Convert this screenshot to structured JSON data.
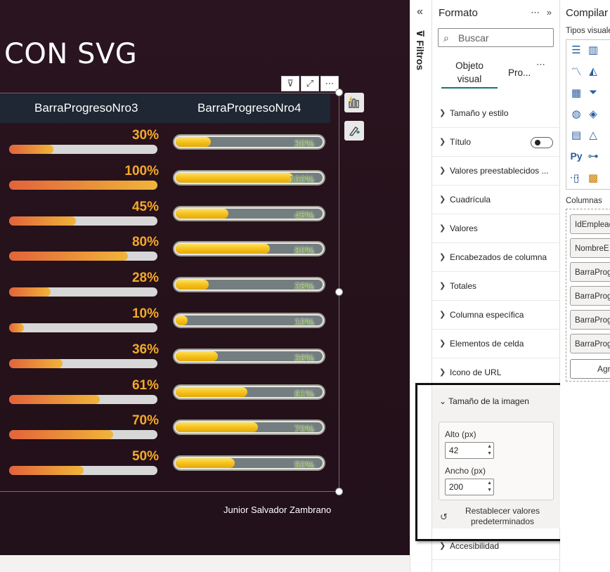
{
  "report": {
    "title": "CON SVG",
    "author": "Junior Salvador Zambrano",
    "column_headers": [
      "BarraProgresoNro3",
      "BarraProgresoNro4"
    ],
    "rows": [
      {
        "label": "30%",
        "value": 30
      },
      {
        "label": "100%",
        "value": 100
      },
      {
        "label": "45%",
        "value": 45
      },
      {
        "label": "80%",
        "value": 80
      },
      {
        "label": "28%",
        "value": 28
      },
      {
        "label": "10%",
        "value": 10
      },
      {
        "label": "36%",
        "value": 36
      },
      {
        "label": "61%",
        "value": 61
      },
      {
        "label": "70%",
        "value": 70
      },
      {
        "label": "50%",
        "value": 50
      }
    ],
    "colors": {
      "bar3_start": "#e2633b",
      "bar3_end": "#f0b53a",
      "pct3_text": "#f4a82a",
      "pct4_text": "#7ea05a",
      "bar4_fill": "#f5c21a",
      "bar4_track": "#747d80"
    }
  },
  "header_icons": [
    "filter-icon",
    "focus-mode-icon",
    "more-options-icon"
  ],
  "header_icon_glyphs": [
    "⊽",
    "⤢",
    "⋯"
  ],
  "filters_pane": {
    "label": "Filtros",
    "collapse_glyph": "«"
  },
  "format_pane": {
    "title": "Formato",
    "actions_glyph": "⋯ »",
    "search_placeholder": "Buscar",
    "tabs": {
      "visual_line1": "Objeto",
      "visual_line2": "visual",
      "properties": "Pro...",
      "more": "⋯"
    },
    "sections": [
      "Tamaño y estilo",
      "Título",
      "Valores preestablecidos ...",
      "Cuadrícula",
      "Valores",
      "Encabezados de columna",
      "Totales",
      "Columna específica",
      "Elementos de celda",
      "Icono de URL"
    ],
    "image_size": {
      "header": "Tamaño de la imagen",
      "height_label": "Alto (px)",
      "height_value": "42",
      "width_label": "Ancho (px)",
      "width_value": "200",
      "reset_line1": "Restablecer valores",
      "reset_line2": "predeterminados"
    },
    "last_section": "Accesibilidad"
  },
  "build_pane": {
    "title": "Compilar",
    "viz_types_label": "Tipos visuale",
    "columns_label": "Columnas",
    "wells": [
      "IdEmplead",
      "NombreE",
      "BarraProg",
      "BarraProg",
      "BarraProg",
      "BarraProg"
    ],
    "add_label": "Agr"
  }
}
